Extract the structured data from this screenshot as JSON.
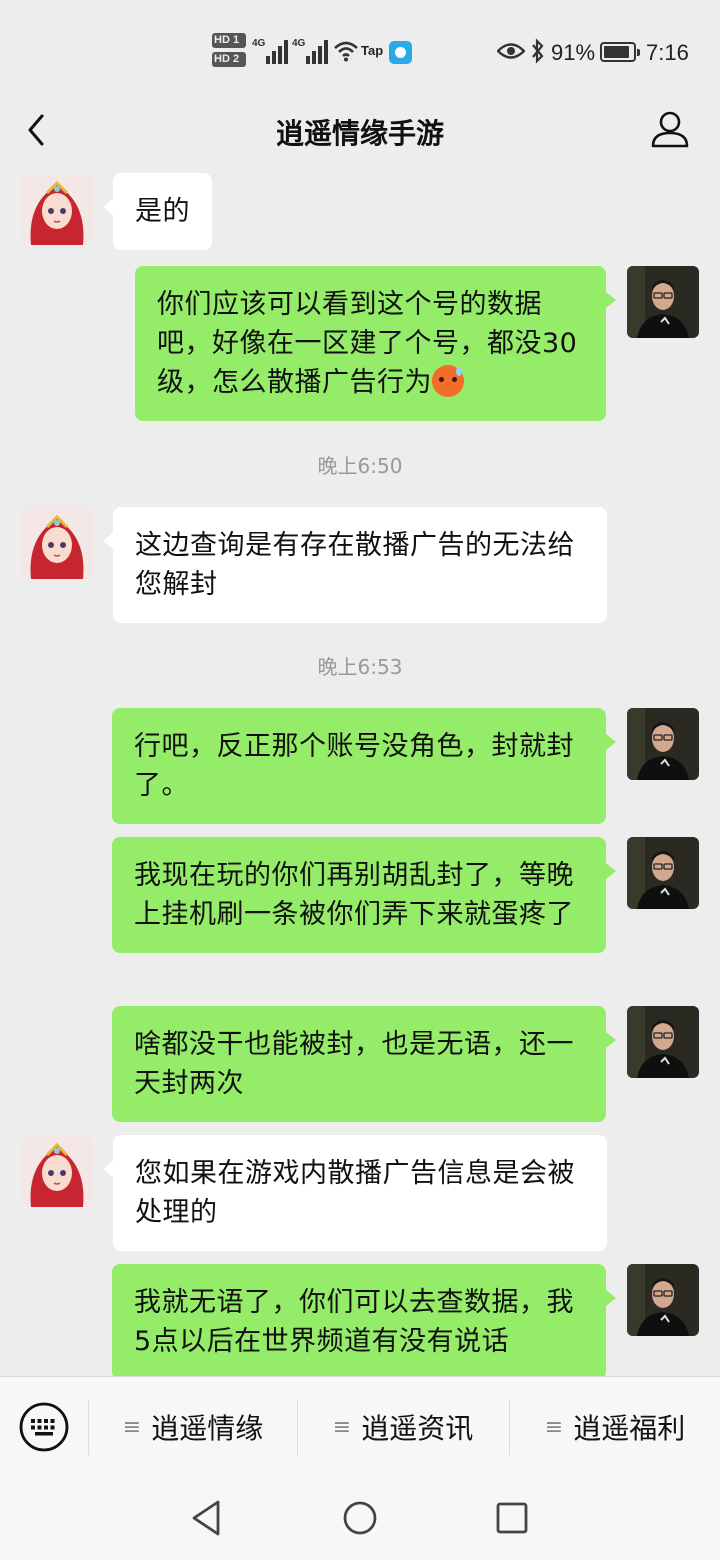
{
  "status_bar": {
    "hd1": "HD 1",
    "hd2": "HD 2",
    "net1": "4G",
    "net2": "4G",
    "tap_label": "Tap",
    "battery_percent": "91%",
    "battery_level": 0.91,
    "time": "7:16",
    "icons": [
      "hd-badge",
      "signal-icon",
      "wifi-icon",
      "tap-app-icon",
      "eye-icon",
      "bluetooth-icon",
      "battery-icon"
    ]
  },
  "header": {
    "title": "逍遥情缘手游",
    "back_icon": "chevron-left-icon",
    "profile_icon": "person-icon"
  },
  "messages": [
    {
      "side": "left",
      "text": "是的"
    },
    {
      "side": "right",
      "text": "你们应该可以看到这个号的数据吧，好像在一区建了个号，都没30级，怎么散播广告行为",
      "emoji": "sweat-angry-emoji"
    },
    {
      "type": "time",
      "text": "晚上6:50"
    },
    {
      "side": "left",
      "text": "这边查询是有存在散播广告的无法给您解封"
    },
    {
      "type": "time",
      "text": "晚上6:53"
    },
    {
      "side": "right",
      "text": "行吧，反正那个账号没角色，封就封了。"
    },
    {
      "side": "right",
      "text": "我现在玩的你们再别胡乱封了，等晚上挂机刷一条被你们弄下来就蛋疼了"
    },
    {
      "side": "right",
      "text": "啥都没干也能被封，也是无语，还一天封两次"
    },
    {
      "side": "left",
      "text": "您如果在游戏内散播广告信息是会被处理的"
    },
    {
      "side": "right",
      "text": "我就无语了，你们可以去查数据，我5点以后在世界频道有没有说话"
    }
  ],
  "menu": {
    "keyboard_icon": "keyboard-icon",
    "items": [
      {
        "label": "逍遥情缘"
      },
      {
        "label": "逍遥资讯"
      },
      {
        "label": "逍遥福利"
      }
    ]
  },
  "nav": {
    "back": "triangle-back-icon",
    "home": "circle-home-icon",
    "recents": "square-recents-icon"
  },
  "colors": {
    "background": "#ededed",
    "bubble_self": "#95ec69",
    "bubble_other": "#ffffff",
    "timestamp": "#999999"
  }
}
